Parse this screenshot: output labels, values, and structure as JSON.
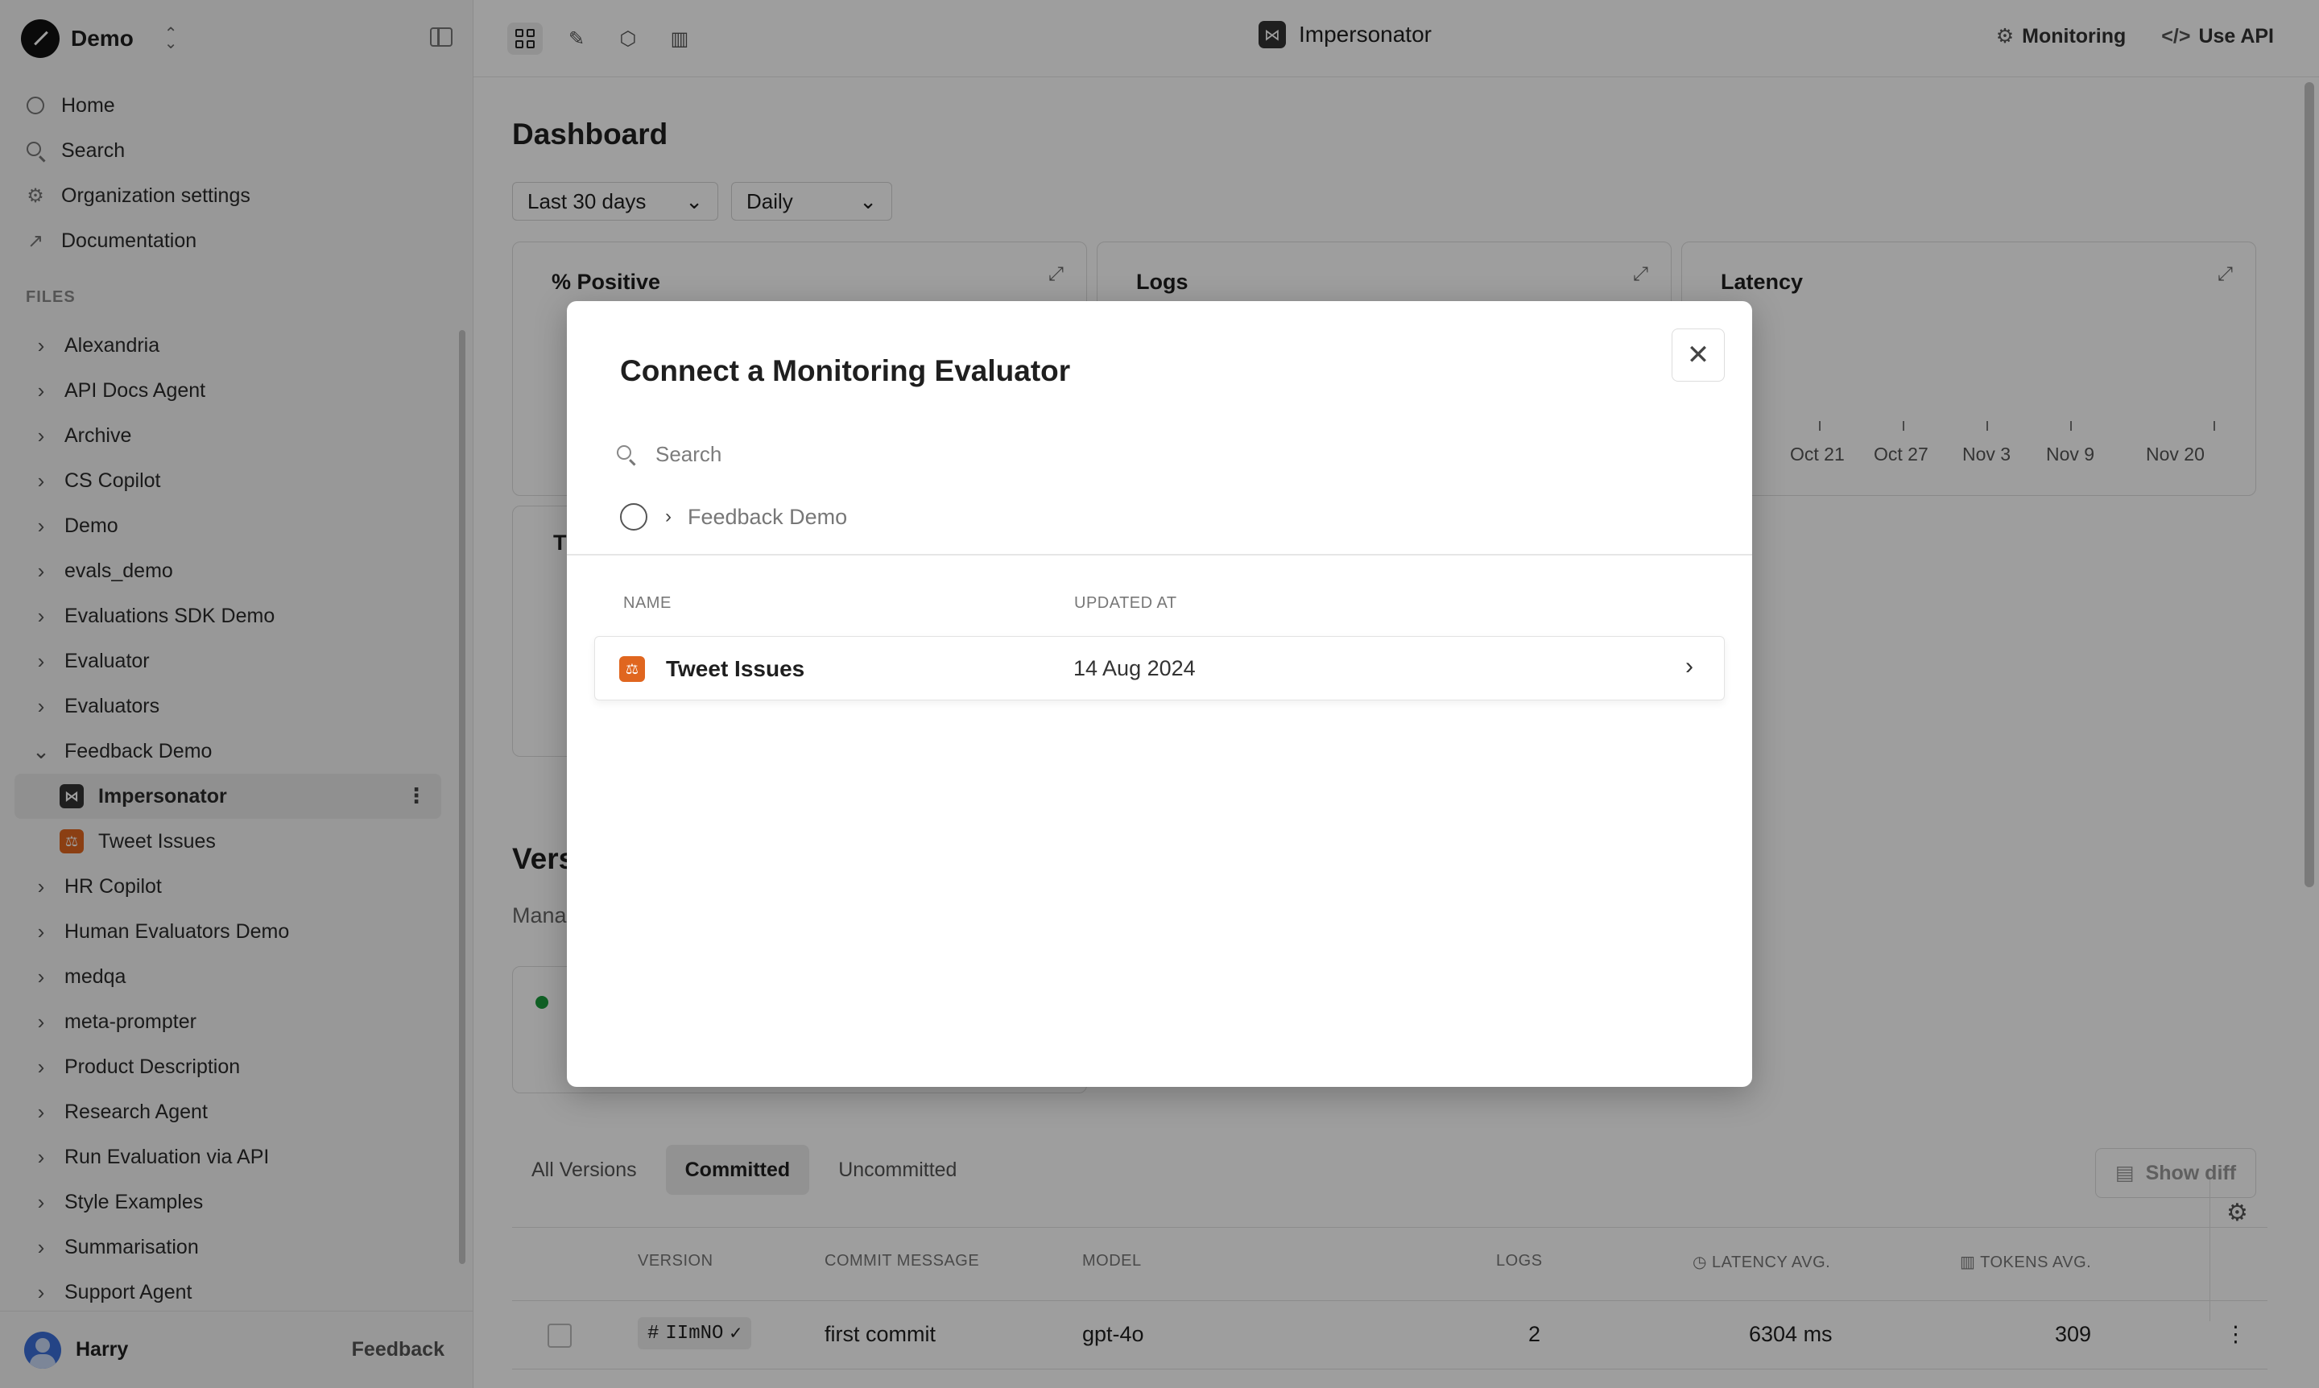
{
  "workspace": {
    "name": "Demo"
  },
  "nav": [
    {
      "label": "Home",
      "icon": "home-icon"
    },
    {
      "label": "Search",
      "icon": "search-icon"
    },
    {
      "label": "Organization settings",
      "icon": "gear-icon"
    },
    {
      "label": "Documentation",
      "icon": "external-link-icon"
    }
  ],
  "files_label": "FILES",
  "tree": [
    "Alexandria",
    "API Docs Agent",
    "Archive",
    "CS Copilot",
    "Demo",
    "evals_demo",
    "Evaluations SDK Demo",
    "Evaluator",
    "Evaluators",
    "Feedback Demo",
    "Impersonator",
    "Tweet Issues",
    "HR Copilot",
    "Human Evaluators Demo",
    "medqa",
    "meta-prompter",
    "Product Description",
    "Research Agent",
    "Run Evaluation via API",
    "Style Examples",
    "Summarisation",
    "Support Agent"
  ],
  "user": {
    "name": "Harry",
    "feedback_label": "Feedback"
  },
  "topbar": {
    "title": "Impersonator",
    "monitoring_label": "Monitoring",
    "use_api_label": "Use API"
  },
  "dashboard": {
    "title": "Dashboard",
    "range_select": "Last 30 days",
    "granularity_select": "Daily",
    "cards": [
      {
        "title": "% Positive"
      },
      {
        "title": "Logs"
      },
      {
        "title": "Latency"
      }
    ],
    "latency_ticks": [
      "Oct 21",
      "Oct 27",
      "Nov 3",
      "Nov 9",
      "Nov 20"
    ],
    "card2_title_fragment": "T",
    "versions_title_fragment": "Vers",
    "versions_sub_fragment": "Mana"
  },
  "versions": {
    "tabs": [
      "All Versions",
      "Committed",
      "Uncommitted"
    ],
    "active_tab": "Committed",
    "show_diff_label": "Show diff",
    "columns": [
      "VERSION",
      "COMMIT MESSAGE",
      "MODEL",
      "LOGS",
      "LATENCY AVG.",
      "TOKENS AVG."
    ],
    "rows": [
      {
        "version": "IImNO",
        "commit_message": "first commit",
        "model": "gpt-4o",
        "logs": "2",
        "latency": "6304 ms",
        "tokens": "309"
      }
    ]
  },
  "modal": {
    "title": "Connect a Monitoring Evaluator",
    "search_placeholder": "Search",
    "folder": "Feedback Demo",
    "columns": {
      "name": "NAME",
      "updated_at": "UPDATED AT"
    },
    "rows": [
      {
        "name": "Tweet Issues",
        "updated_at": "14 Aug 2024",
        "icon": "evaluator-icon"
      }
    ]
  },
  "colors": {
    "accent_orange": "#e0661f",
    "status_green": "#1a9c3c",
    "overlay": "rgba(0,0,0,0.38)"
  }
}
